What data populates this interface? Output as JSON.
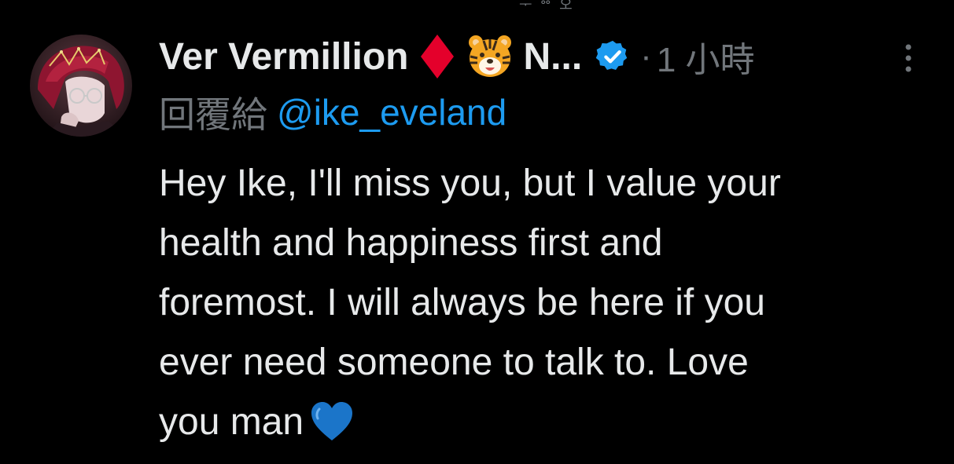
{
  "top_remnant": "ᅮ ᅘ 오",
  "tweet": {
    "display_name": "Ver Vermillion",
    "name_truncated": "N...",
    "dot": "·",
    "timestamp": "1 小時",
    "reply_label": "回覆給",
    "reply_handle": "@ike_eveland",
    "text_lines": [
      "Hey Ike, I'll miss you, but I value your",
      "health and happiness first and",
      "foremost. I will always be here if you",
      "ever need someone to talk to. Love",
      "you man"
    ]
  },
  "icons": {
    "diamond": "diamond-suit-icon",
    "tiger": "tiger-face-icon",
    "verified": "verified-badge-icon",
    "more": "more-options-icon",
    "heart": "blue-heart-icon"
  },
  "colors": {
    "background": "#000000",
    "primary_text": "#e7e9ea",
    "secondary_text": "#71767b",
    "link": "#1d9bf0",
    "diamond": "#e4002b",
    "heart": "#1b75c9"
  }
}
